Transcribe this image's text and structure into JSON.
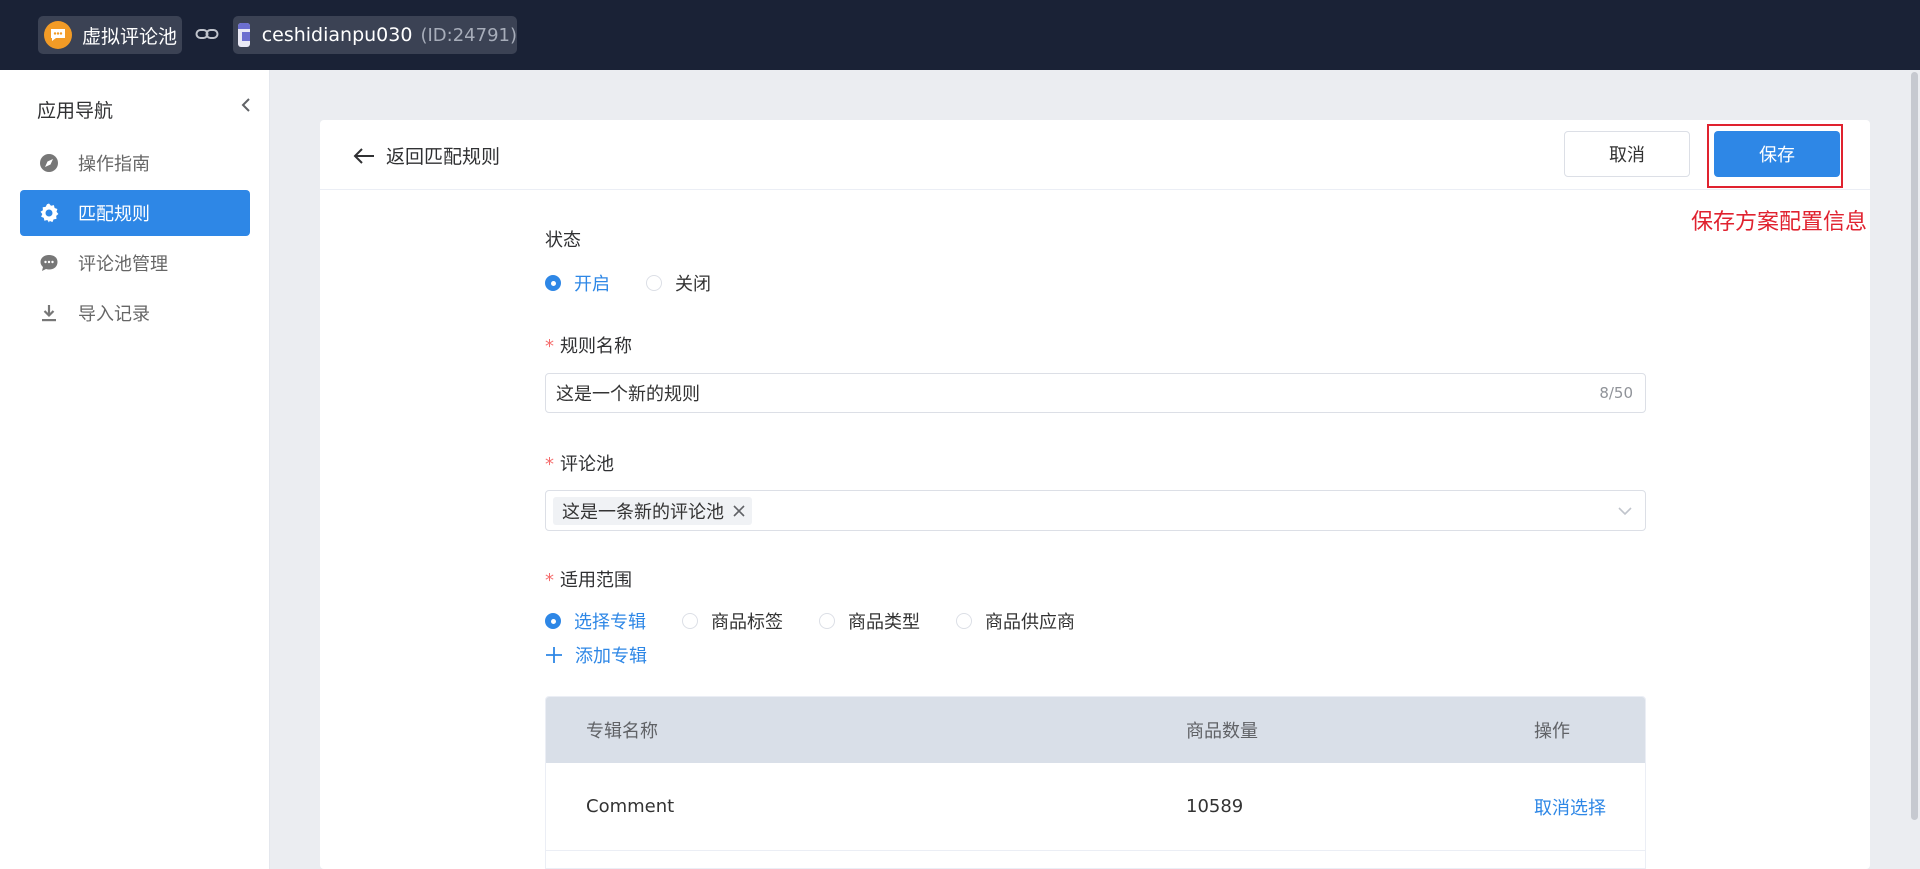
{
  "topbar": {
    "app_name": "虚拟评论池",
    "store_name": "ceshidianpu030",
    "store_id": "(ID:24791)"
  },
  "sidebar": {
    "title": "应用导航",
    "items": [
      {
        "label": "操作指南",
        "icon": "compass-icon",
        "active": false
      },
      {
        "label": "匹配规则",
        "icon": "gear-icon",
        "active": true
      },
      {
        "label": "评论池管理",
        "icon": "chat-bubble-icon",
        "active": false
      },
      {
        "label": "导入记录",
        "icon": "download-icon",
        "active": false
      }
    ]
  },
  "header": {
    "back_label": "返回匹配规则",
    "cancel_label": "取消",
    "save_label": "保存",
    "annotation": "保存方案配置信息"
  },
  "form": {
    "status": {
      "label": "状态",
      "options": [
        "开启",
        "关闭"
      ],
      "selected": "开启"
    },
    "rule_name": {
      "label": "规则名称",
      "required_mark": "*",
      "value": "这是一个新的规则",
      "counter": "8/50"
    },
    "comment_pool": {
      "label": "评论池",
      "required_mark": "*",
      "tags": [
        "这是一条新的评论池"
      ]
    },
    "scope": {
      "label": "适用范围",
      "required_mark": "*",
      "options": [
        "选择专辑",
        "商品标签",
        "商品类型",
        "商品供应商"
      ],
      "selected": "选择专辑",
      "add_label": "添加专辑"
    },
    "table": {
      "columns": [
        "专辑名称",
        "商品数量",
        "操作"
      ],
      "rows": [
        {
          "name": "Comment",
          "count": "10589",
          "action": "取消选择"
        }
      ]
    }
  },
  "colors": {
    "primary": "#2e87e6",
    "topbar_bg": "#1a2236",
    "annotation_red": "#e0222f"
  }
}
